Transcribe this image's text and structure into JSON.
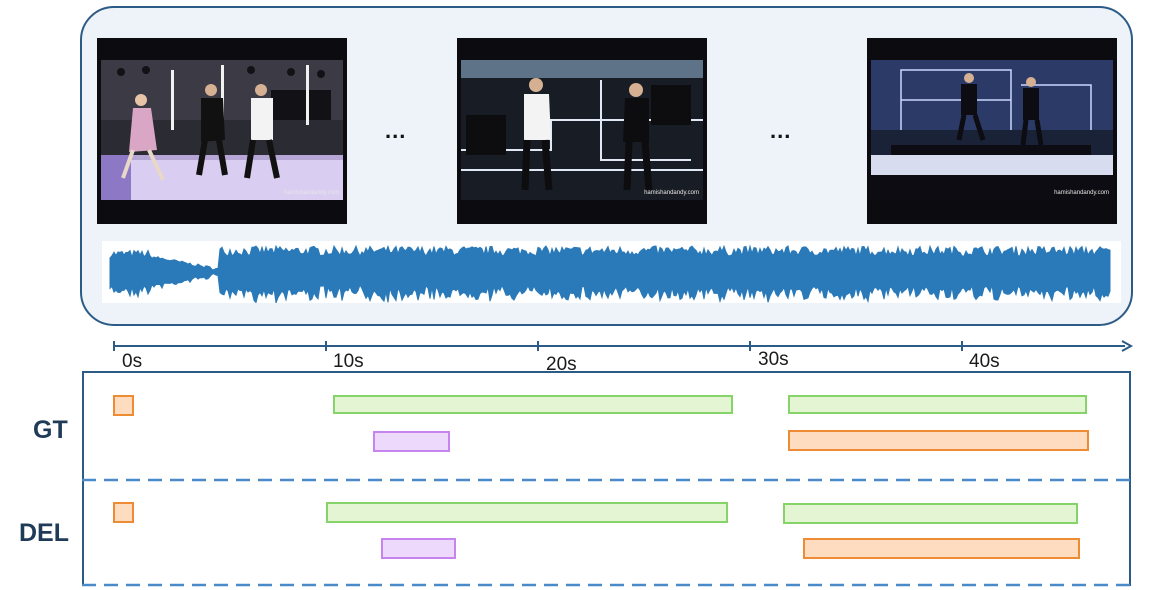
{
  "frames": [
    {
      "name": "frame-1",
      "watermark": "hamishandandy.com"
    },
    {
      "name": "frame-2",
      "watermark": "hamishandandy.com"
    },
    {
      "name": "frame-3",
      "watermark": "hamishandandy.com"
    }
  ],
  "ellipsis": "...",
  "timeline": {
    "ticks": [
      "0s",
      "10s",
      "20s",
      "30s",
      "40s"
    ]
  },
  "rows": {
    "gt_label": "GT",
    "del_label": "DEL"
  },
  "colors": {
    "panel_border": "#2c5b86",
    "waveform": "#2a79b8",
    "green_fill": "#e3f5d2",
    "green_border": "#86d36a",
    "purple_fill": "#ecd9fb",
    "purple_border": "#c685ee",
    "orange_fill": "#fddcc0",
    "orange_border": "#ee8b35",
    "dashed_line": "#4a8ac8"
  }
}
